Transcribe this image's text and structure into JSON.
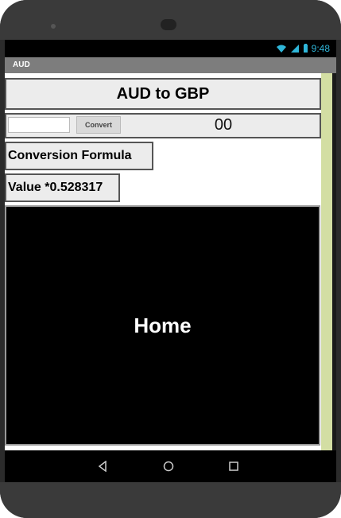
{
  "status": {
    "time": "9:48"
  },
  "app": {
    "title": "AUD"
  },
  "main": {
    "heading": "AUD to GBP",
    "amount_input": {
      "value": "",
      "placeholder": ""
    },
    "convert_label": "Convert",
    "result": "00",
    "formula_label": "Conversion Formula",
    "formula_value": "Value *0.528317",
    "home_label": "Home"
  },
  "nav": {
    "back": "back-icon",
    "home": "home-icon",
    "recents": "recents-icon"
  },
  "colors": {
    "status_accent": "#2fb6d9",
    "titlebar": "#7d7d7d",
    "scrollbar": "#d3dea3"
  }
}
